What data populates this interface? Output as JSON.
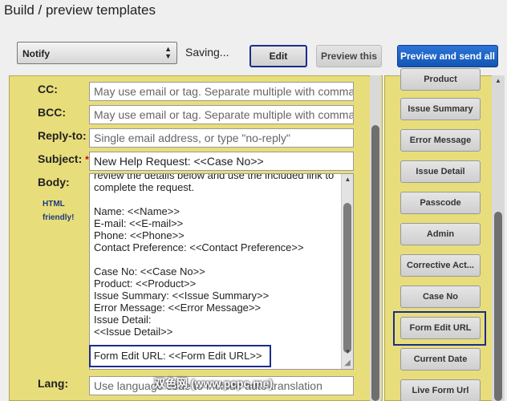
{
  "page_title": "Build / preview templates",
  "toolbar": {
    "select_value": "Notify",
    "saving_text": "Saving...",
    "edit_label": "Edit",
    "preview_label": "Preview this",
    "send_label": "Preview and send all"
  },
  "form": {
    "cc": {
      "label": "CC:",
      "placeholder": "May use email or tag. Separate multiple with commas."
    },
    "bcc": {
      "label": "BCC:",
      "placeholder": "May use email or tag. Separate multiple with commas."
    },
    "reply_to": {
      "label": "Reply-to:",
      "placeholder": "Single email address, or type \"no-reply\""
    },
    "subject": {
      "label": "Subject:",
      "required_mark": "*",
      "value": "New Help Request: <<Case No>>"
    },
    "body": {
      "label": "Body:",
      "note_line1": "HTML",
      "note_line2": "friendly!",
      "lines": [
        "review the details below and use the included link to",
        "complete the request.",
        "",
        "Name: <<Name>>",
        "E-mail: <<E-mail>>",
        "Phone: <<Phone>>",
        "Contact Preference: <<Contact Preference>>",
        "",
        "Case No: <<Case No>>",
        "Product: <<Product>>",
        "Issue Summary: <<Issue Summary>>",
        "Error Message: <<Error Message>>",
        "Issue Detail:",
        "<<Issue Detail>>",
        "",
        "Form Edit URL: <<Form Edit URL>>"
      ]
    },
    "lang": {
      "label": "Lang:",
      "placeholder": "Use language code to include auto-translation"
    }
  },
  "side_buttons": [
    "Product",
    "Issue Summary",
    "Error Message",
    "Issue Detail",
    "Passcode",
    "Admin",
    "Corrective Act...",
    "Case No",
    "Form Edit URL",
    "Current Date",
    "Live Form Url"
  ],
  "watermark": "双色网 (www.pcpc.me)"
}
